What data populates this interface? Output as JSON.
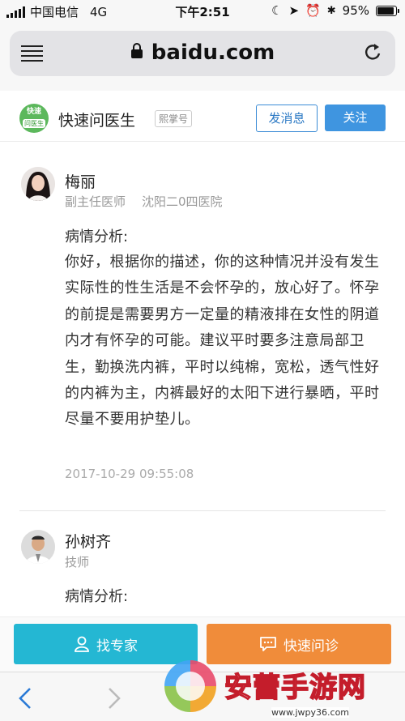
{
  "status_bar": {
    "carrier": "中国电信",
    "network": "4G",
    "time": "下午2:51",
    "battery": "95%",
    "battery_level": 0.95
  },
  "browser": {
    "url": "baidu.com"
  },
  "site_header": {
    "logo_line1": "快速",
    "logo_line2": "问医生",
    "title": "快速问医生",
    "badge": "熙掌号",
    "message_button": "发消息",
    "follow_button": "关注"
  },
  "answers": [
    {
      "doctor_name": "梅丽",
      "title": "副主任医师",
      "hospital": "沈阳二0四医院",
      "analysis_label": "病情分析:",
      "body": "你好，根据你的描述，你的这种情况并没有发生实际性的性生活是不会怀孕的，放心好了。怀孕的前提是需要男方一定量的精液排在女性的阴道内才有怀孕的可能。建议平时要多注意局部卫生，勤换洗内裤，平时以纯棉，宽松，透气性好的内裤为主，内裤最好的太阳下进行暴晒，平时尽量不要用护垫儿。",
      "timestamp": "2017-10-29 09:55:08"
    },
    {
      "doctor_name": "孙树齐",
      "title": "技师",
      "analysis_label": "病情分析:"
    }
  ],
  "action_bar": {
    "find_expert": "找专家",
    "quick_consult": "快速问诊"
  },
  "watermark": {
    "text": "安蕾手游网",
    "url": "www.jwpy36.com"
  },
  "colors": {
    "accent_blue": "#3f95e0",
    "expert_button": "#24b7d3",
    "consult_button": "#f08c3a",
    "logo_green": "#5cb85c"
  }
}
